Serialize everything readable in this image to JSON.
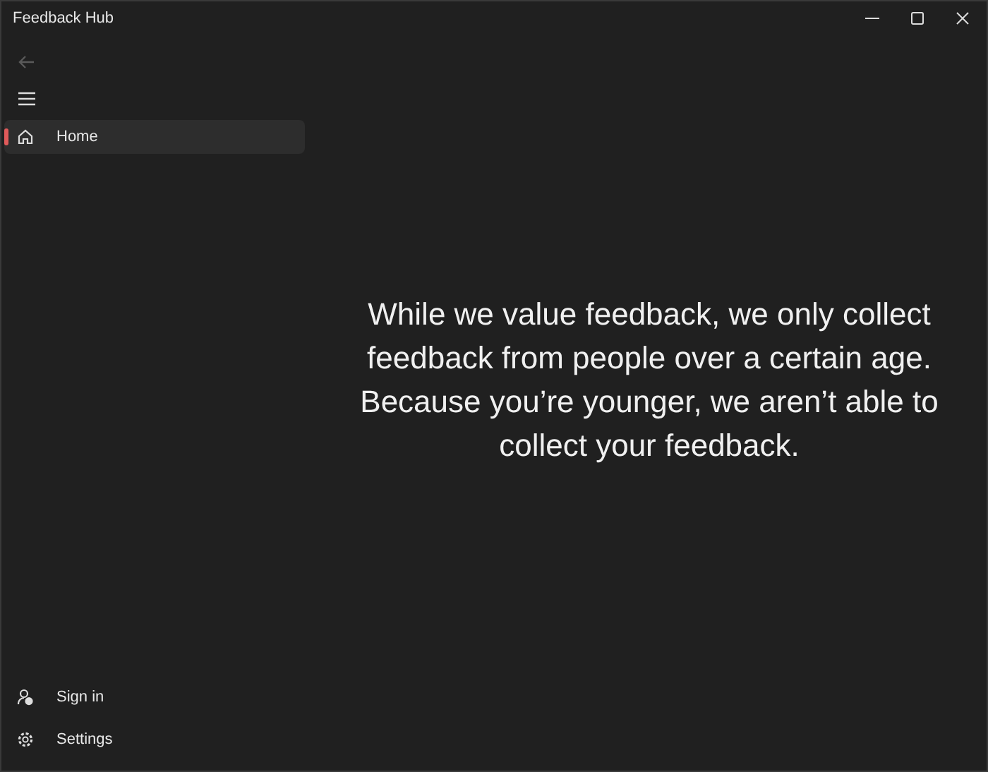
{
  "window": {
    "title": "Feedback Hub"
  },
  "back_button": {
    "disabled": true
  },
  "nav_items": [
    {
      "label": "Home",
      "selected": true
    }
  ],
  "footer_items": [
    {
      "kind": "sign-in",
      "label": "Sign in"
    },
    {
      "kind": "settings",
      "label": "Settings"
    }
  ],
  "message": "While we value feedback, we only collect feedback from people over a certain age. Because you’re younger, we aren’t able to collect your feedback."
}
